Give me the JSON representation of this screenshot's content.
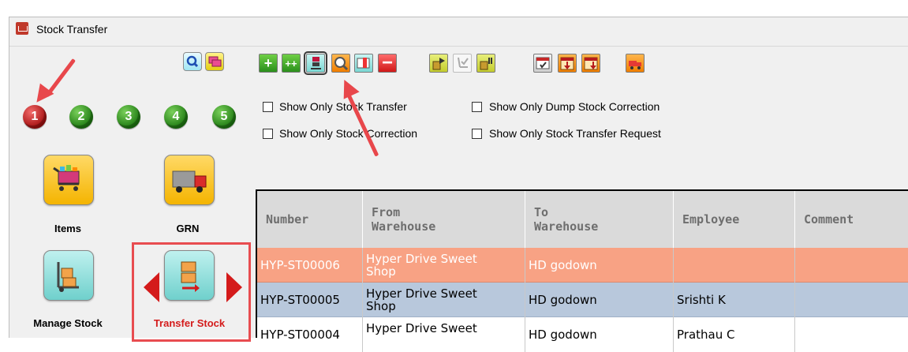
{
  "window": {
    "title": "Stock Transfer"
  },
  "left_panel": {
    "page_buttons": [
      "1",
      "2",
      "3",
      "4",
      "5"
    ],
    "modules": [
      {
        "label": "Items",
        "icon": "shopping-cart-icon"
      },
      {
        "label": "GRN",
        "icon": "delivery-truck-icon"
      },
      {
        "label": "Manage Stock",
        "icon": "hand-trolley-icon"
      },
      {
        "label": "Transfer Stock",
        "icon": "transfer-boxes-icon"
      }
    ],
    "selected_module": "Transfer Stock"
  },
  "toolbar": {
    "buttons": [
      "add-icon",
      "add-multiple-icon",
      "transfer-stock-icon",
      "search-icon",
      "import-icon",
      "delete-icon",
      "send-icon",
      "receive-icon",
      "return-icon",
      "check-list-icon",
      "export-down-icon",
      "export-all-icon",
      "truck-icon"
    ]
  },
  "filters": [
    {
      "label": "Show Only Stock Transfer",
      "checked": false
    },
    {
      "label": "Show Only Dump Stock Correction",
      "checked": false
    },
    {
      "label": "Show Only Stock Correction",
      "checked": false
    },
    {
      "label": "Show Only Stock Transfer Request",
      "checked": false
    }
  ],
  "grid": {
    "headers": {
      "number": "Number",
      "from_1": "From",
      "from_2": "Warehouse",
      "to_1": "To",
      "to_2": "Warehouse",
      "employee": "Employee",
      "comment": "Comment"
    },
    "rows": [
      {
        "number": "HYP-ST00006",
        "from_1": "Hyper Drive Sweet",
        "from_2": "Shop",
        "to": "HD godown",
        "employee": "",
        "comment": ""
      },
      {
        "number": "HYP-ST00005",
        "from_1": "Hyper Drive Sweet",
        "from_2": "Shop",
        "to": "HD godown",
        "employee": "Srishti K",
        "comment": ""
      },
      {
        "number": "HYP-ST00004",
        "from_1": "Hyper Drive Sweet",
        "from_2": "",
        "to": "HD godown",
        "employee": "Prathau C",
        "comment": ""
      }
    ],
    "row_colors": [
      "#f8a284",
      "#b8c8dc",
      "#ffffff"
    ],
    "header_color": "#dadada"
  },
  "colors": {
    "accent_red": "#e8474b",
    "selected_row": "#f8a284",
    "alt_row": "#b8c8dc"
  }
}
